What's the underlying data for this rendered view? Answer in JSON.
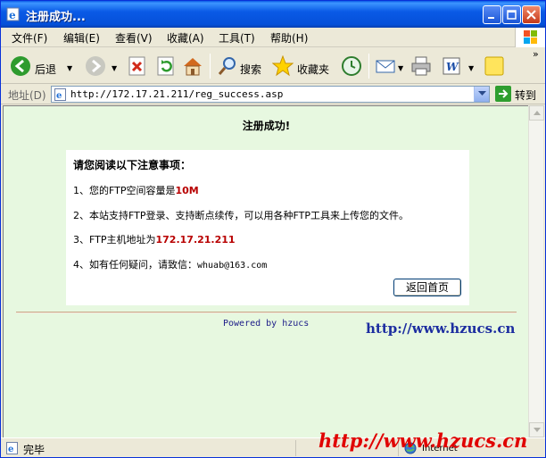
{
  "window": {
    "title": "注册成功..."
  },
  "menu": {
    "items": [
      {
        "label": "文件(F)"
      },
      {
        "label": "编辑(E)"
      },
      {
        "label": "查看(V)"
      },
      {
        "label": "收藏(A)"
      },
      {
        "label": "工具(T)"
      },
      {
        "label": "帮助(H)"
      }
    ]
  },
  "toolbar": {
    "back_label": "后退",
    "search_label": "搜索",
    "favorites_label": "收藏夹",
    "overflow": "»"
  },
  "address": {
    "label": "地址(D)",
    "url": "http://172.17.21.211/reg_success.asp",
    "go_label": "转到"
  },
  "page": {
    "heading": "注册成功!",
    "notice_title": "请您阅读以下注意事项：",
    "item1_prefix": "1、您的FTP空间容量是",
    "item1_value": "10M",
    "item2": "2、本站支持FTP登录、支持断点续传，可以用各种FTP工具来上传您的文件。",
    "item3_prefix": "3、FTP主机地址为",
    "item3_value": "172.17.21.211",
    "item4_prefix": "4、如有任何疑问，请致信：",
    "item4_email": "whuab@163.com",
    "back_button": "返回首页",
    "powered_by": "Powered by hzucs",
    "site_link": "http://www.hzucs.cn"
  },
  "status": {
    "text": "完毕",
    "zone": "Internet",
    "watermark": "http://www.hzucs.cn"
  },
  "colors": {
    "content_bg": "#e7f8e0",
    "title_bar": "#0a5ae6",
    "highlight_red": "#b80000",
    "link_blue": "#1c2da0",
    "watermark_red": "#e00000"
  }
}
